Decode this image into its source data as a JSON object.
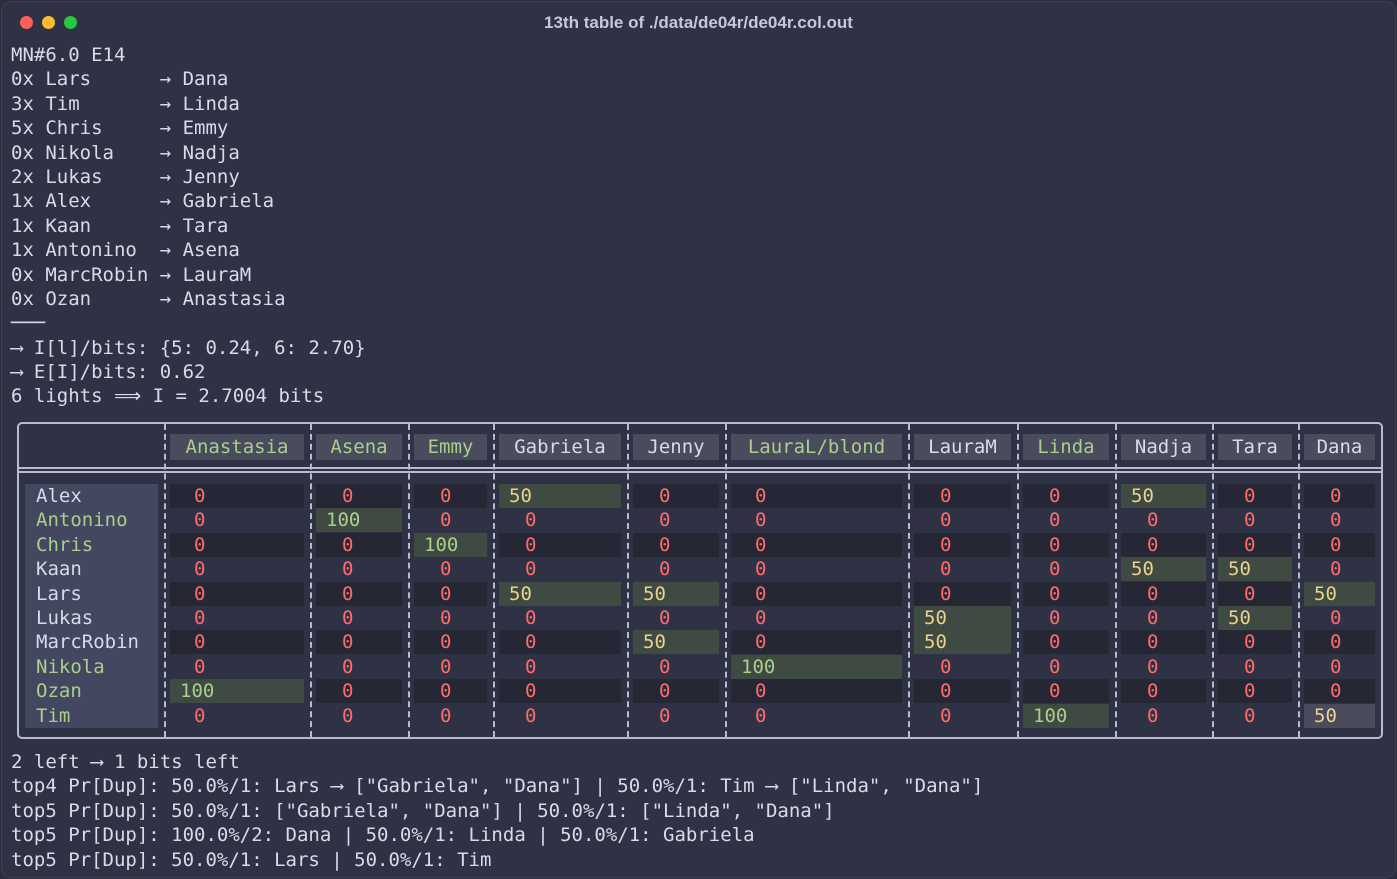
{
  "window": {
    "title": "13th table of ./data/de04r/de04r.col.out"
  },
  "top_lines": [
    "MN#6.0 E14",
    "0x Lars      → Dana",
    "3x Tim       → Linda",
    "5x Chris     → Emmy",
    "0x Nikola    → Nadja",
    "2x Lukas     → Jenny",
    "1x Alex      → Gabriela",
    "1x Kaan      → Tara",
    "1x Antonino  → Asena",
    "0x MarcRobin → LauraM",
    "0x Ozan      → Anastasia",
    "───",
    "⟶ I[l]/bits: {5: 0.24, 6: 2.70}",
    "⟶ E[I]/bits: 0.62",
    "6 lights ⟹ I = 2.7004 bits"
  ],
  "table": {
    "columns": [
      "Anastasia",
      "Asena",
      "Emmy",
      "Gabriela",
      "Jenny",
      "LauraL/blond",
      "LauraM",
      "Linda",
      "Nadja",
      "Tara",
      "Dana"
    ],
    "rows": [
      {
        "name": "Alex",
        "values": [
          "0",
          "0",
          "0",
          "50",
          "0",
          "0",
          "0",
          "0",
          "50",
          "0",
          "0"
        ]
      },
      {
        "name": "Antonino",
        "values": [
          "0",
          "100",
          "0",
          "0",
          "0",
          "0",
          "0",
          "0",
          "0",
          "0",
          "0"
        ]
      },
      {
        "name": "Chris",
        "values": [
          "0",
          "0",
          "100",
          "0",
          "0",
          "0",
          "0",
          "0",
          "0",
          "0",
          "0"
        ]
      },
      {
        "name": "Kaan",
        "values": [
          "0",
          "0",
          "0",
          "0",
          "0",
          "0",
          "0",
          "0",
          "50",
          "50",
          "0"
        ]
      },
      {
        "name": "Lars",
        "values": [
          "0",
          "0",
          "0",
          "50",
          "50",
          "0",
          "0",
          "0",
          "0",
          "0",
          "50"
        ]
      },
      {
        "name": "Lukas",
        "values": [
          "0",
          "0",
          "0",
          "0",
          "0",
          "0",
          "50",
          "0",
          "0",
          "50",
          "0"
        ]
      },
      {
        "name": "MarcRobin",
        "values": [
          "0",
          "0",
          "0",
          "0",
          "50",
          "0",
          "50",
          "0",
          "0",
          "0",
          "0"
        ]
      },
      {
        "name": "Nikola",
        "values": [
          "0",
          "0",
          "0",
          "0",
          "0",
          "100",
          "0",
          "0",
          "0",
          "0",
          "0"
        ]
      },
      {
        "name": "Ozan",
        "values": [
          "100",
          "0",
          "0",
          "0",
          "0",
          "0",
          "0",
          "0",
          "0",
          "0",
          "0"
        ]
      },
      {
        "name": "Tim",
        "values": [
          "0",
          "0",
          "0",
          "0",
          "0",
          "0",
          "0",
          "100",
          "0",
          "0",
          "50"
        ]
      }
    ]
  },
  "bottom_lines": [
    "2 left ⟶ 1 bits left",
    "top4 Pr[Dup]: 50.0%/1: Lars ⟶ [\"Gabriela\", \"Dana\"] | 50.0%/1: Tim ⟶ [\"Linda\", \"Dana\"]",
    "top5 Pr[Dup]: 50.0%/1: [\"Gabriela\", \"Dana\"] | 50.0%/1: [\"Linda\", \"Dana\"]",
    "top5 Pr[Dup]: 100.0%/2: Dana | 50.0%/1: Linda | 50.0%/1: Gabriela",
    "top5 Pr[Dup]: 50.0%/1: Lars | 50.0%/1: Tim"
  ]
}
